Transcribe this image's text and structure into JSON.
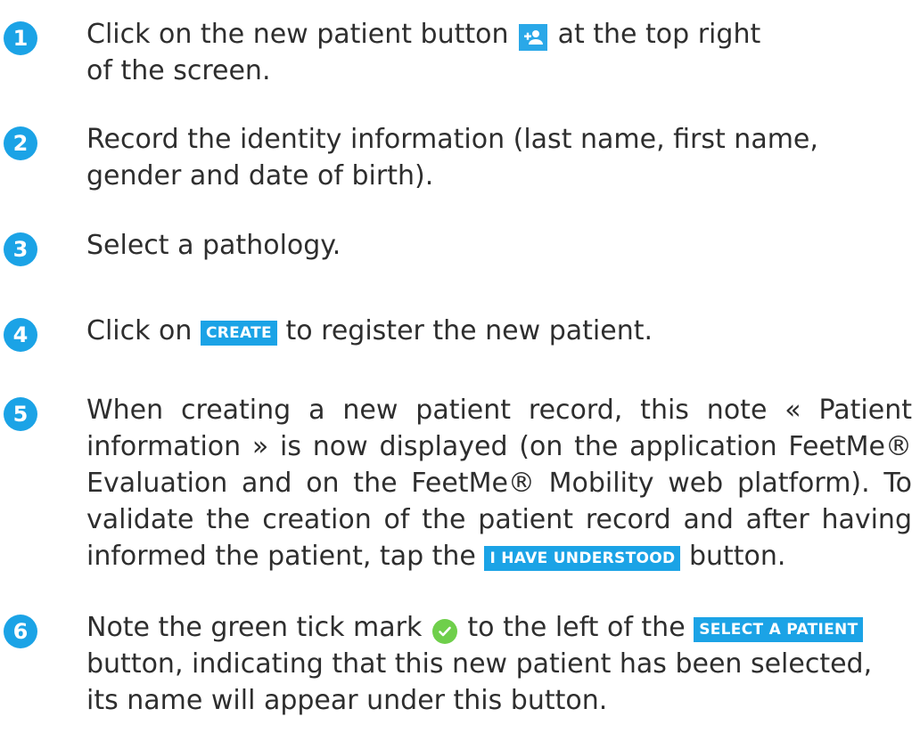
{
  "steps": [
    {
      "number": "1",
      "l1a": "Click on the new patient button",
      "l1b": "at the top right",
      "l2": "of the screen."
    },
    {
      "number": "2",
      "l1": "Record the identity information (last name, first name,",
      "l2": "gender and date of birth)."
    },
    {
      "number": "3",
      "l1": "Select a pathology."
    },
    {
      "number": "4",
      "l1a": "Click on",
      "button": "CREATE",
      "l1b": "to register the new patient."
    },
    {
      "number": "5",
      "l1": "When creating a new patient record, this note « Patient",
      "l2": "information » is now displayed (on the application FeetMe®",
      "l3": "Evaluation and on the FeetMe® Mobility web platform). To",
      "l4": "validate the creation of the patient record and after having",
      "l5a": "informed the patient, tap the",
      "button": "I HAVE UNDERSTOOD",
      "l5b": "button."
    },
    {
      "number": "6",
      "l1a": "Note the green tick mark",
      "l1b": "to the left of the",
      "button": "SELECT A PATIENT",
      "l2": "button, indicating that this new patient has been selected,",
      "l3": "its name will appear under this button."
    }
  ],
  "icons": {
    "new_patient": "add-person-icon",
    "tick": "check-circle-icon"
  },
  "colors": {
    "accent": "#1ba3e6",
    "tick": "#6fcf4b",
    "text": "#2e2e2e"
  }
}
